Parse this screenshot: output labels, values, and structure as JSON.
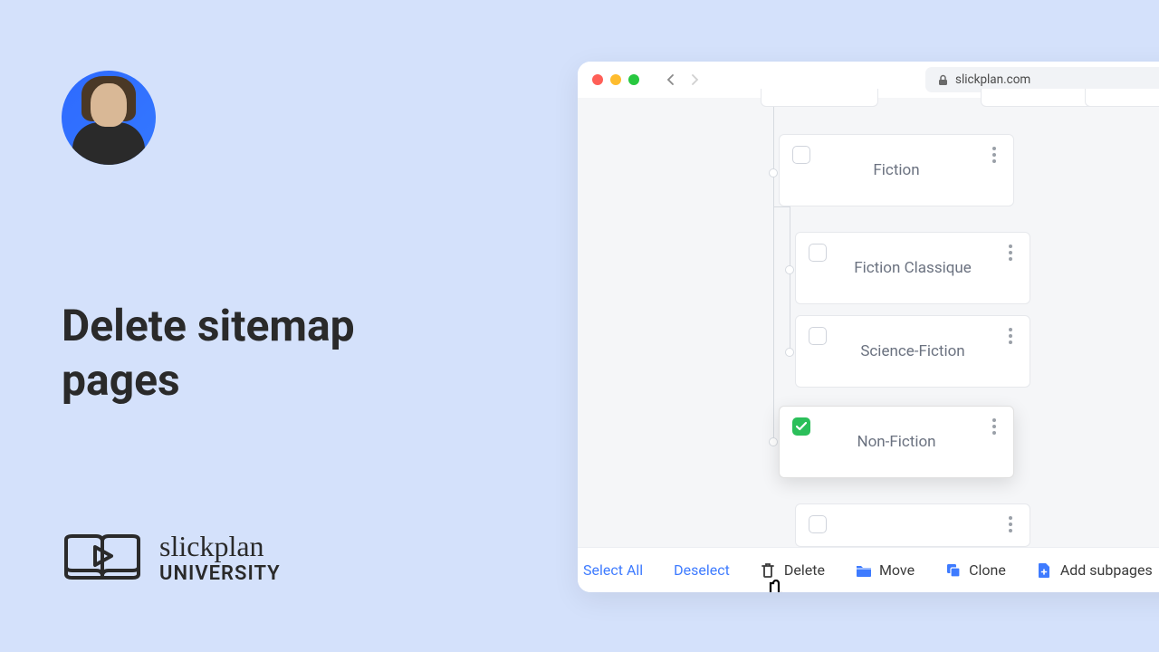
{
  "title": "Delete sitemap\npages",
  "brand": {
    "script": "slickplan",
    "sub": "UNIVERSITY"
  },
  "browser": {
    "url": "slickplan.com"
  },
  "cards": {
    "fiction": "Fiction",
    "fiction_classique": "Fiction Classique",
    "science_fiction": "Science-Fiction",
    "non_fiction": "Non-Fiction"
  },
  "toolbar": {
    "select_all": "Select All",
    "deselect": "Deselect",
    "delete": "Delete",
    "move": "Move",
    "clone": "Clone",
    "add_subpages": "Add subpages"
  }
}
